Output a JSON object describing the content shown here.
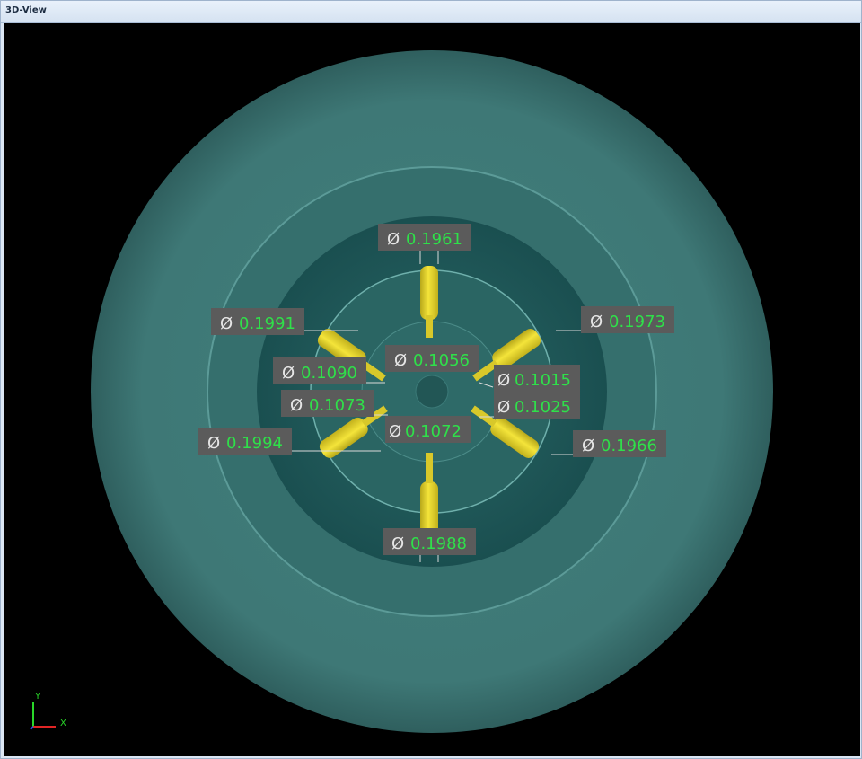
{
  "window": {
    "title": "3D-View"
  },
  "measurements": [
    {
      "symbol": "Ø",
      "value": "0.1961"
    },
    {
      "symbol": "Ø",
      "value": "0.1991"
    },
    {
      "symbol": "Ø",
      "value": "0.1973"
    },
    {
      "symbol": "Ø",
      "value": "0.1056"
    },
    {
      "symbol": "Ø",
      "value": "0.1090"
    },
    {
      "symbol": "Ø",
      "value": "0.1015"
    },
    {
      "symbol": "Ø",
      "value": "0.1073"
    },
    {
      "symbol": "Ø",
      "value": "0.1025"
    },
    {
      "symbol": "Ø",
      "value": "0.1072"
    },
    {
      "symbol": "Ø",
      "value": "0.1994"
    },
    {
      "symbol": "Ø",
      "value": "0.1966"
    },
    {
      "symbol": "Ø",
      "value": "0.1988"
    }
  ],
  "axis_triad": {
    "y_label": "Y",
    "x_label": "X"
  },
  "colors": {
    "part_outer": "#3f7f7c",
    "part_mid": "#2f6b69",
    "part_inner": "#1f5656",
    "holes": "#e9d62a",
    "label_box": "#5b5b5b",
    "label_value": "#2fe04a",
    "label_symbol": "#e6e6e6"
  }
}
